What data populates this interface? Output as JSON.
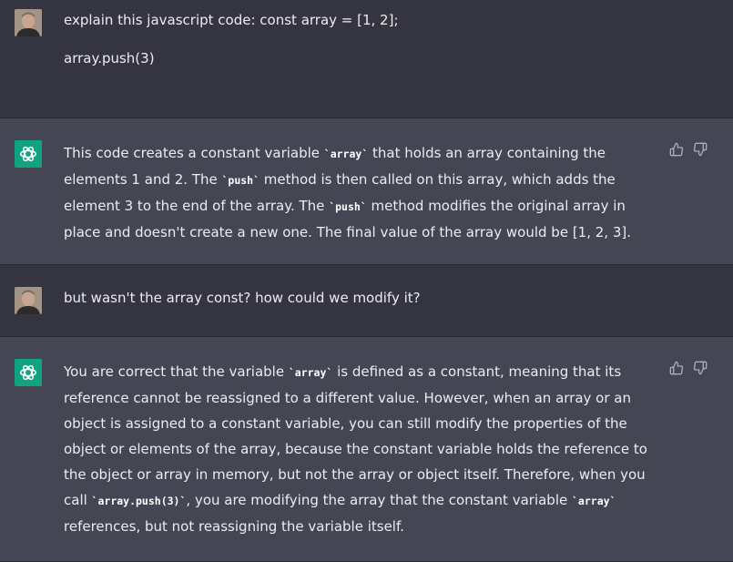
{
  "messages": [
    {
      "role": "user",
      "paragraphs": [
        "explain this javascript code: const array = [1, 2];",
        "array.push(3)"
      ]
    },
    {
      "role": "assistant",
      "segments": [
        "This code creates a constant variable ",
        "`array`",
        " that holds an array containing the elements 1 and 2. The ",
        "`push`",
        " method is then called on this array, which adds the element 3 to the end of the array. The ",
        "`push`",
        " method modifies the original array in place and doesn't create a new one. The final value of the array would be [1, 2, 3]."
      ]
    },
    {
      "role": "user",
      "paragraphs": [
        "but wasn't the array const? how could we modify it?"
      ]
    },
    {
      "role": "assistant",
      "segments": [
        "You are correct that the variable ",
        "`array`",
        " is defined as a constant, meaning that its reference cannot be reassigned to a different value. However, when an array or an object is assigned to a constant variable, you can still modify the properties of the object or elements of the array, because the constant variable holds the reference to the object or array in memory, but not the array or object itself. Therefore, when you call ",
        "`array.push(3)`",
        ", you are modifying the array that the constant variable ",
        "`array`",
        " references, but not reassigning the variable itself."
      ]
    }
  ],
  "icons": {
    "user_avatar": "user-avatar-photo",
    "assistant_avatar": "openai-logo-icon",
    "like": "thumbs-up-icon",
    "dislike": "thumbs-down-icon"
  },
  "colors": {
    "user_bg": "#343541",
    "assistant_bg": "#444654",
    "brand": "#10a37f",
    "text": "#ececf1"
  }
}
